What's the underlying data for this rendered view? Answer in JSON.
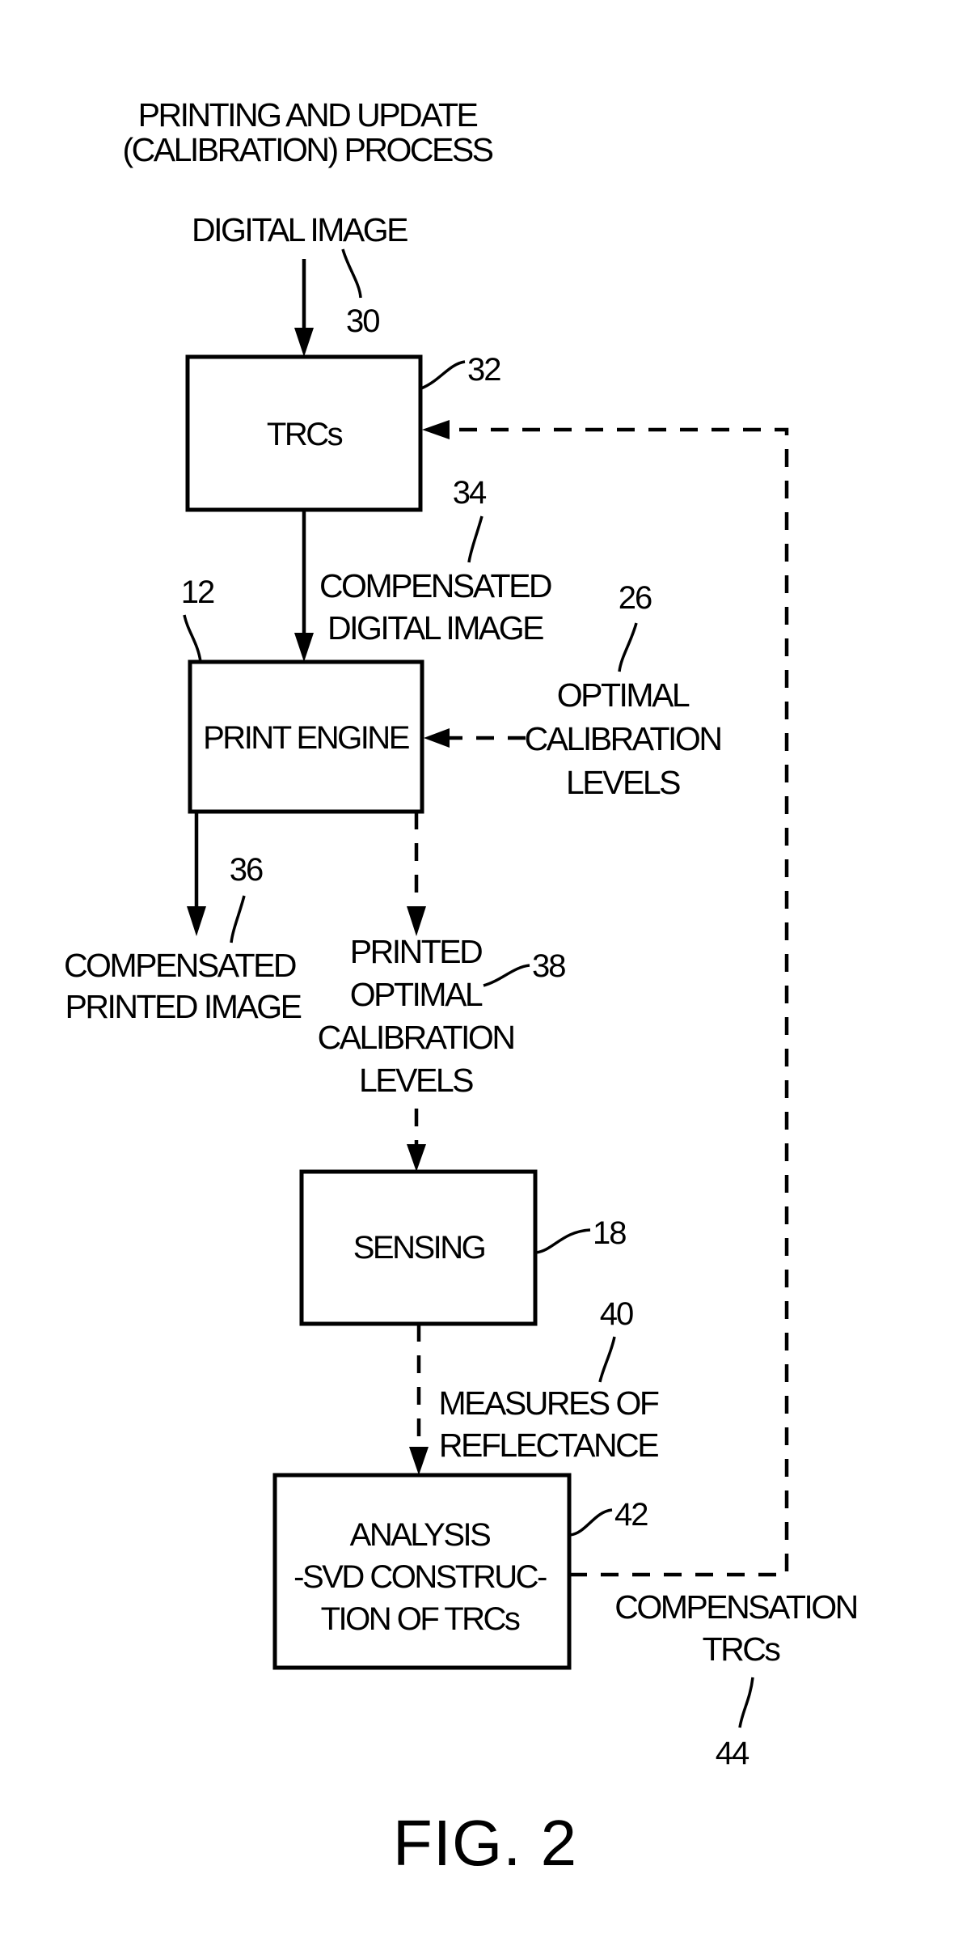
{
  "figure": {
    "title_lines": [
      "PRINTING AND UPDATE",
      "(CALIBRATION) PROCESS"
    ],
    "caption": "FIG. 2"
  },
  "blocks": {
    "trcs": {
      "label_lines": [
        "TRCs"
      ],
      "ref": "32"
    },
    "print_engine": {
      "label_lines": [
        "PRINT ENGINE"
      ],
      "ref": "12"
    },
    "sensing": {
      "label_lines": [
        "SENSING"
      ],
      "ref": "18"
    },
    "analysis": {
      "label_lines": [
        "ANALYSIS",
        "-SVD CONSTRUC-",
        "TION OF TRCs"
      ],
      "ref": "42"
    }
  },
  "signals": {
    "digital_image": {
      "label_lines": [
        "DIGITAL IMAGE"
      ],
      "ref": "30"
    },
    "compensated_digital_image": {
      "label_lines": [
        "COMPENSATED",
        "DIGITAL IMAGE"
      ],
      "ref": "34"
    },
    "optimal_calibration_levels": {
      "label_lines": [
        "OPTIMAL",
        "CALIBRATION",
        "LEVELS"
      ],
      "ref": "26"
    },
    "compensated_printed_image": {
      "label_lines": [
        "COMPENSATED",
        "PRINTED IMAGE"
      ],
      "ref": "36"
    },
    "printed_optimal_calibration_levels": {
      "label_lines": [
        "PRINTED",
        "OPTIMAL",
        "CALIBRATION",
        "LEVELS"
      ],
      "ref": "38"
    },
    "measures_of_reflectance": {
      "label_lines": [
        "MEASURES OF",
        "REFLECTANCE"
      ],
      "ref": "40"
    },
    "compensation_trcs": {
      "label_lines": [
        "COMPENSATION",
        "TRCs"
      ],
      "ref": "44"
    }
  },
  "connections": [
    {
      "from": "digital_image",
      "to": "trcs",
      "style": "solid"
    },
    {
      "from": "trcs",
      "to": "print_engine",
      "style": "solid"
    },
    {
      "from": "optimal_calibration_levels",
      "to": "print_engine",
      "style": "dashed"
    },
    {
      "from": "print_engine",
      "to": "compensated_printed_image",
      "style": "solid"
    },
    {
      "from": "print_engine",
      "to": "sensing",
      "style": "dashed"
    },
    {
      "from": "sensing",
      "to": "analysis",
      "style": "dashed"
    },
    {
      "from": "analysis",
      "to": "trcs",
      "style": "dashed"
    }
  ]
}
